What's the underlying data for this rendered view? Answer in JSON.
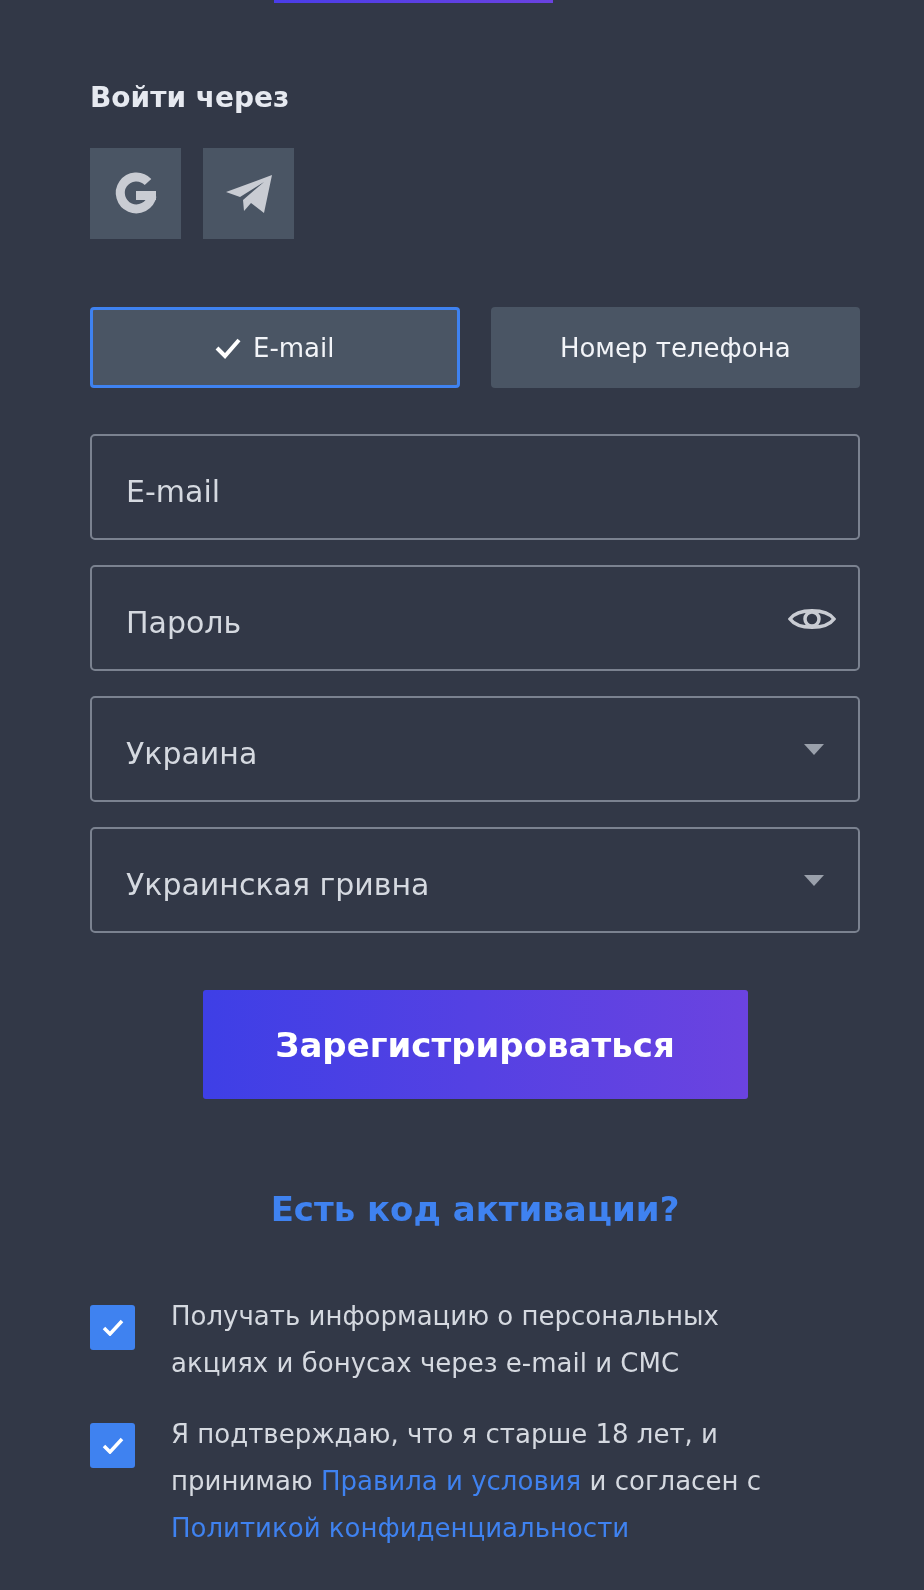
{
  "login_with": {
    "title": "Войти через",
    "providers": [
      {
        "kind": "google"
      },
      {
        "kind": "telegram"
      }
    ]
  },
  "method_tabs": [
    {
      "label": "E-mail",
      "selected": true
    },
    {
      "label": "Номер телефона",
      "selected": false
    }
  ],
  "fields": [
    {
      "kind": "text",
      "placeholder": "E-mail"
    },
    {
      "kind": "password",
      "placeholder": "Пароль"
    },
    {
      "kind": "select",
      "value": "Украина"
    },
    {
      "kind": "select",
      "value": "Украинская гривна"
    }
  ],
  "register_button": "Зарегистрироваться",
  "activation_link": "Есть код активации?",
  "agreements": [
    {
      "checked": true,
      "parts": [
        {
          "kind": "text",
          "text": "Получать информацию о персональных акциях и бонусах через e-mail и СМС"
        }
      ]
    },
    {
      "checked": true,
      "parts": [
        {
          "kind": "text",
          "text": "Я подтверждаю, что я старше 18 лет, и принимаю "
        },
        {
          "kind": "link",
          "text": "Правила и условия"
        },
        {
          "kind": "text",
          "text": " и согласен с "
        },
        {
          "kind": "link",
          "text": "Политикой конфиденциальности"
        }
      ]
    }
  ]
}
